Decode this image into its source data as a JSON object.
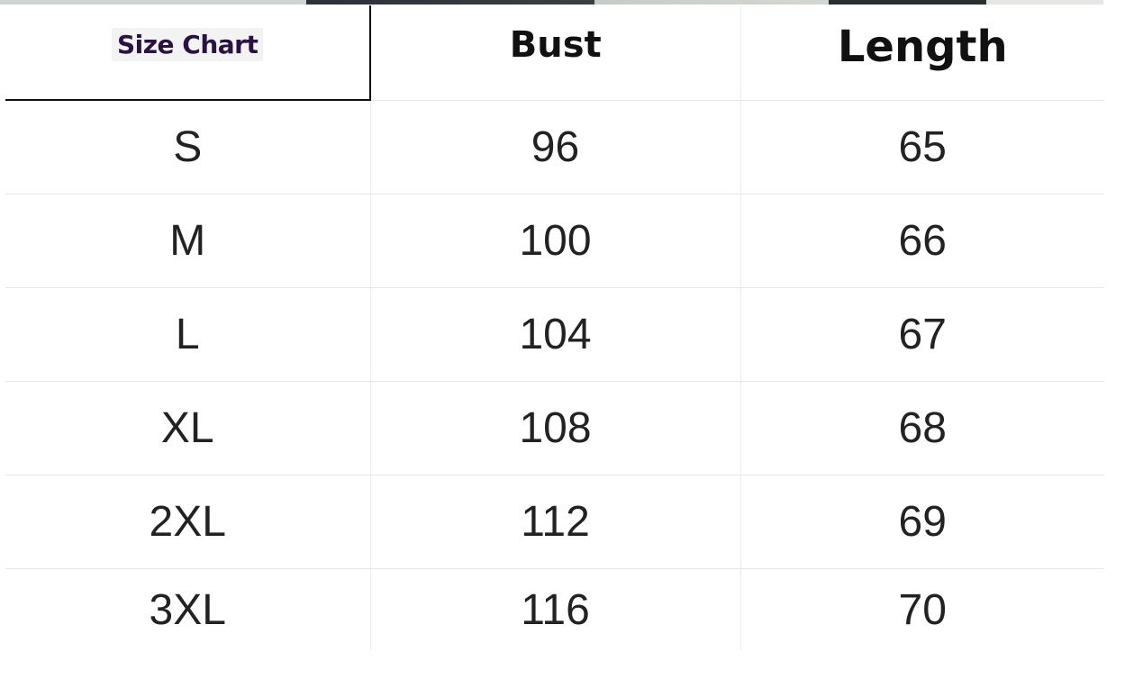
{
  "table": {
    "header": {
      "corner_label": "Size Chart",
      "columns": [
        "Bust",
        "Length"
      ]
    },
    "rows": [
      {
        "size": "S",
        "bust": "96",
        "length": "65"
      },
      {
        "size": "M",
        "bust": "100",
        "length": "66"
      },
      {
        "size": "L",
        "bust": "104",
        "length": "67"
      },
      {
        "size": "XL",
        "bust": "108",
        "length": "68"
      },
      {
        "size": "2XL",
        "bust": "112",
        "length": "69"
      },
      {
        "size": "3XL",
        "bust": "116",
        "length": "70"
      }
    ]
  }
}
